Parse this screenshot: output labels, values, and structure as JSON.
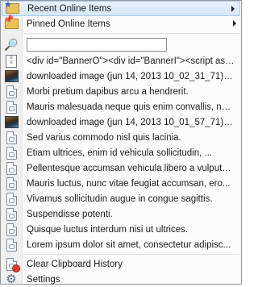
{
  "menu": {
    "recent": "Recent Online Items",
    "pinned": "Pinned Online Items",
    "search_value": "",
    "html_item": "<div id=\"BannerO\"><div id=\"BannerI\"><script asy...",
    "clips": [
      {
        "text": "downloaded image (jun 14, 2013 10_02_31_71).jpg",
        "icon": "image"
      },
      {
        "text": "Morbi pretium dapibus arcu a hendrerit.",
        "icon": "doc"
      },
      {
        "text": "Mauris malesuada neque quis enim convallis, nec...",
        "icon": "doc"
      },
      {
        "text": "downloaded image (jun 14, 2013 10_01_57_71).jpg",
        "icon": "image"
      },
      {
        "text": "Sed varius commodo nisl quis lacinia.",
        "icon": "doc"
      },
      {
        "text": "Etiam ultrices, enim id vehicula sollicitudin, ...",
        "icon": "doc"
      },
      {
        "text": "Pellentesque accumsan vehicula libero a vulputate.",
        "icon": "doc"
      },
      {
        "text": "Mauris luctus, nunc vitae feugiat accumsan, ero...",
        "icon": "doc"
      },
      {
        "text": "Vivamus sollicitudin augue in congue sagittis.",
        "icon": "doc"
      },
      {
        "text": "Suspendisse potenti.",
        "icon": "doc"
      },
      {
        "text": "Quisque luctus interdum nisi ut ultrices.",
        "icon": "doc"
      },
      {
        "text": "Lorem ipsum dolor sit amet, consectetur adipisc...",
        "icon": "doc"
      }
    ],
    "clear": "Clear Clipboard History",
    "settings": "Settings"
  },
  "icons": {
    "recent": "star-folder-icon",
    "pinned": "pin-folder-icon",
    "search": "magnifier-icon",
    "html": "html-document-icon",
    "clear": "clear-history-icon",
    "settings": "gear-icon"
  },
  "colors": {
    "highlight_bg": "#dceafb",
    "highlight_border": "#a9cbee",
    "gutter": "#f0f0f0",
    "menu_border": "#979797"
  }
}
